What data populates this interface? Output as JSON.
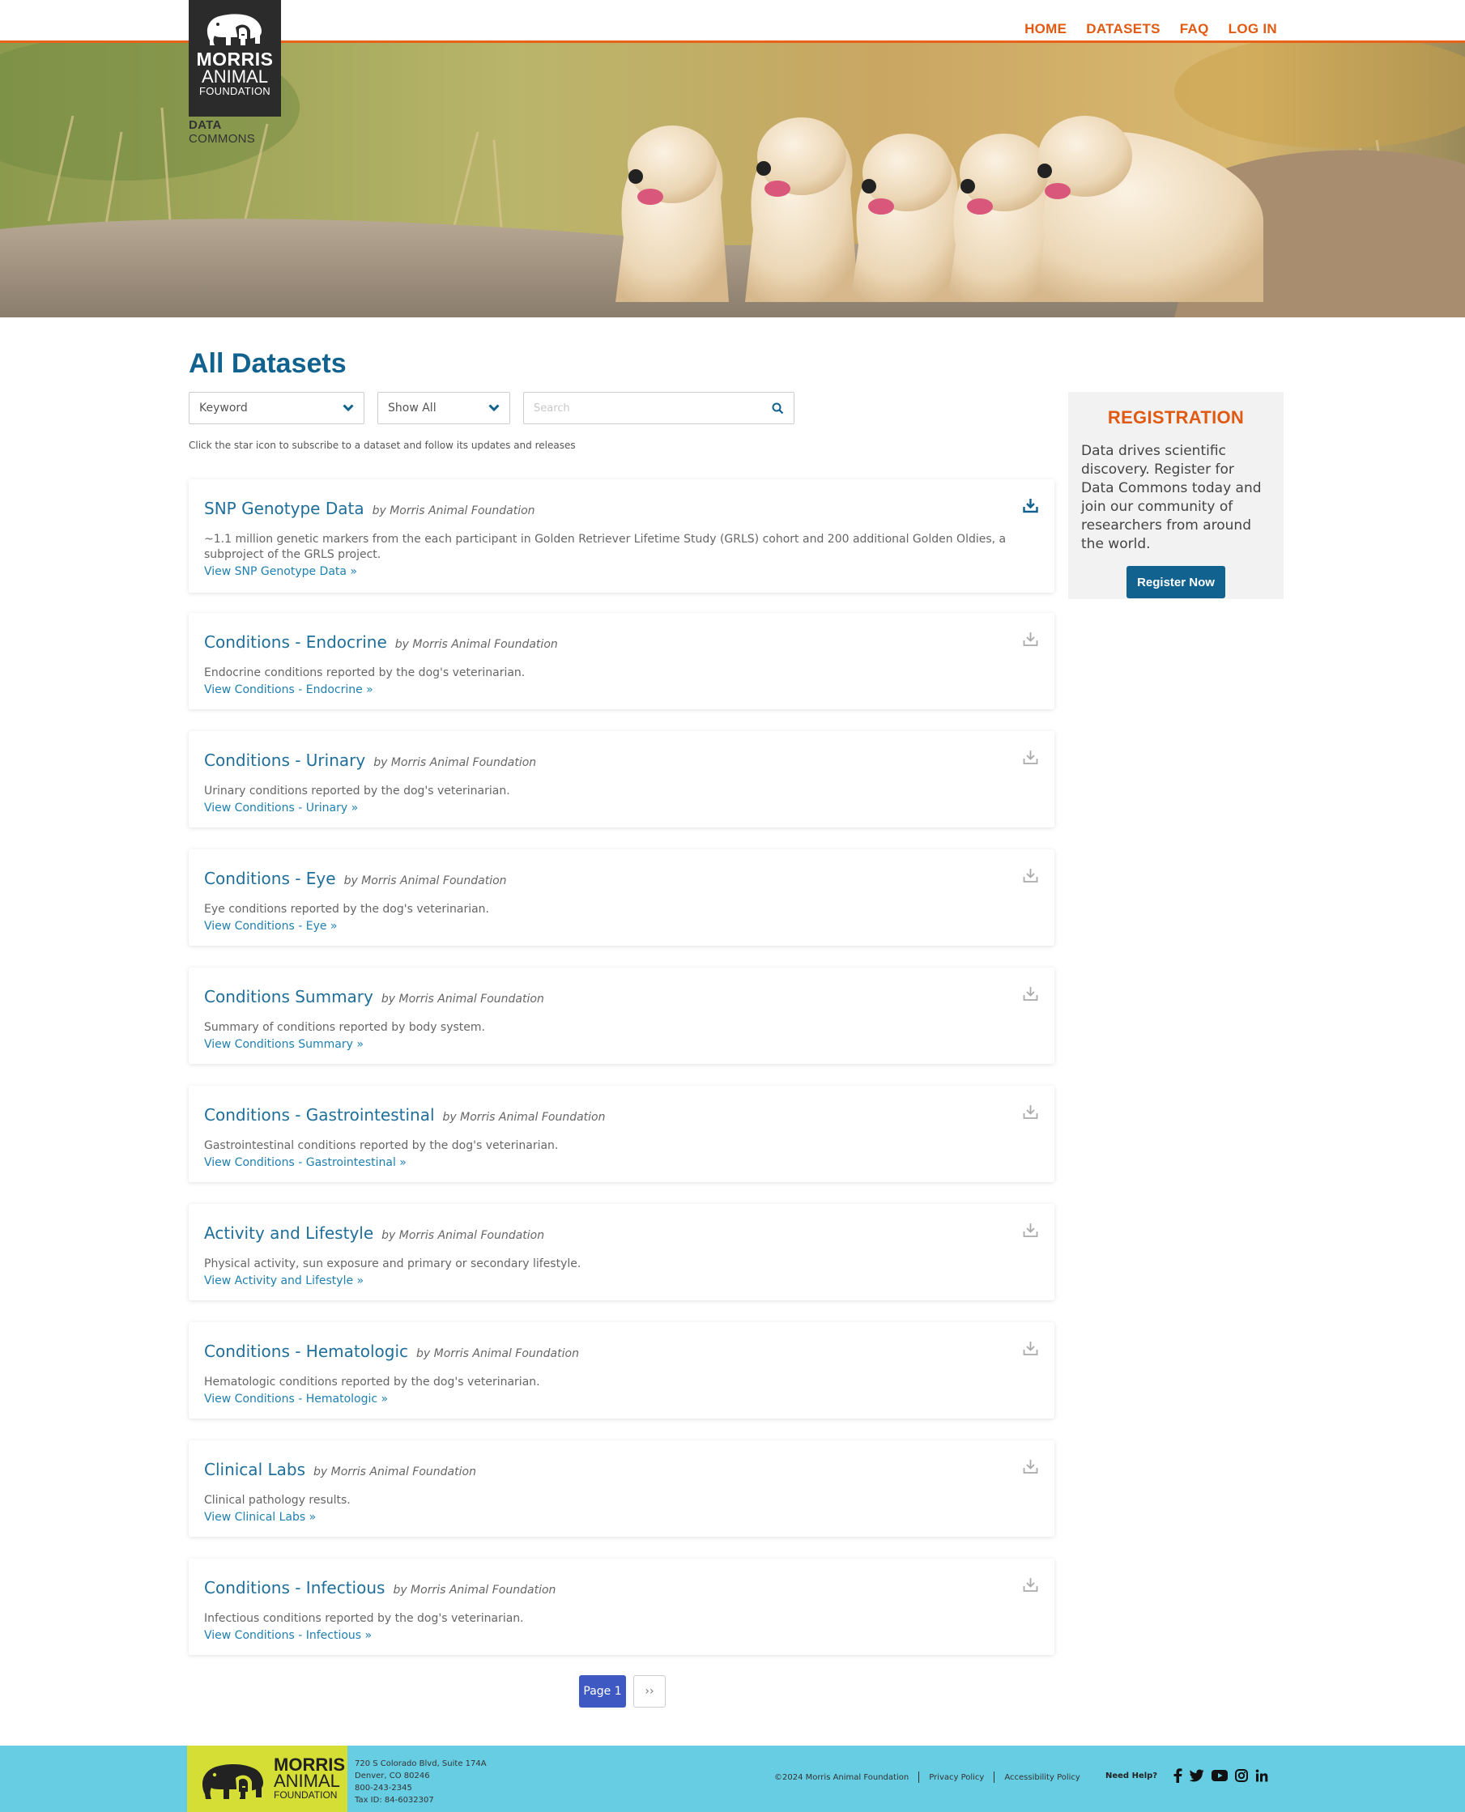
{
  "brand": {
    "line1": "MORRIS",
    "line2": "ANIMAL",
    "line3": "FOUNDATION",
    "sub_bold": "DATA",
    "sub_rest": "COMMONS"
  },
  "nav": [
    "HOME",
    "DATASETS",
    "FAQ",
    "LOG IN"
  ],
  "page_title": "All Datasets",
  "filters": {
    "keyword_label": "Keyword",
    "show_label": "Show All",
    "search_placeholder": "Search"
  },
  "hint": "Click the star icon to subscribe to a dataset and follow its updates and releases",
  "datasets": [
    {
      "title": "SNP Genotype Data",
      "by": "by  Morris Animal Foundation",
      "desc": "~1.1 million genetic markers from the each participant in Golden Retriever Lifetime Study (GRLS) cohort and 200 additional Golden Oldies, a subproject of the GRLS project.",
      "link": "View SNP Genotype Data »",
      "download_active": true
    },
    {
      "title": "Conditions - Endocrine",
      "by": "by  Morris Animal Foundation",
      "desc": "Endocrine conditions reported by the dog's veterinarian.",
      "link": "View Conditions - Endocrine »",
      "download_active": false
    },
    {
      "title": "Conditions - Urinary",
      "by": "by  Morris Animal Foundation",
      "desc": "Urinary conditions reported by the dog's veterinarian.",
      "link": "View Conditions - Urinary »",
      "download_active": false
    },
    {
      "title": "Conditions - Eye",
      "by": "by  Morris Animal Foundation",
      "desc": "Eye conditions reported by the dog's veterinarian.",
      "link": "View Conditions - Eye »",
      "download_active": false
    },
    {
      "title": "Conditions Summary",
      "by": "by  Morris Animal Foundation",
      "desc": "Summary of conditions reported by body system.",
      "link": "View Conditions Summary »",
      "download_active": false
    },
    {
      "title": "Conditions - Gastrointestinal",
      "by": "by  Morris Animal Foundation",
      "desc": "Gastrointestinal conditions reported by the dog's veterinarian.",
      "link": "View Conditions - Gastrointestinal »",
      "download_active": false
    },
    {
      "title": "Activity and Lifestyle",
      "by": "by  Morris Animal Foundation",
      "desc": "Physical activity, sun exposure and primary or secondary lifestyle.",
      "link": "View Activity and Lifestyle »",
      "download_active": false
    },
    {
      "title": "Conditions - Hematologic",
      "by": "by  Morris Animal Foundation",
      "desc": "Hematologic conditions reported by the dog's veterinarian.",
      "link": "View Conditions - Hematologic »",
      "download_active": false
    },
    {
      "title": "Clinical Labs",
      "by": "by  Morris Animal Foundation",
      "desc": "Clinical pathology results.",
      "link": "View Clinical Labs »",
      "download_active": false
    },
    {
      "title": "Conditions - Infectious",
      "by": "by  Morris Animal Foundation",
      "desc": "Infectious conditions reported by the dog's veterinarian.",
      "link": "View Conditions - Infectious »",
      "download_active": false
    }
  ],
  "pagination": {
    "current": "Page 1",
    "next": "››"
  },
  "registration": {
    "title": "REGISTRATION",
    "text": "Data drives scientific discovery. Register for Data Commons today and join our community of researchers from around the world.",
    "button": "Register Now"
  },
  "footer": {
    "address": [
      "720 S Colorado Blvd, Suite 174A",
      "Denver, CO 80246",
      "800-243-2345",
      "Tax ID: 84-6032307"
    ],
    "copyright": "©2024 Morris Animal Foundation",
    "privacy": "Privacy Policy",
    "accessibility": "Accessibility Policy",
    "help": "Need Help?",
    "social_icons": [
      "facebook-icon",
      "twitter-icon",
      "youtube-icon",
      "instagram-icon",
      "linkedin-icon"
    ]
  },
  "colors": {
    "accent": "#e05a12",
    "primary": "#11628f",
    "link": "#1f80b0",
    "footer_bg": "#67cde2",
    "footer_logo_bg": "#d4de34"
  }
}
